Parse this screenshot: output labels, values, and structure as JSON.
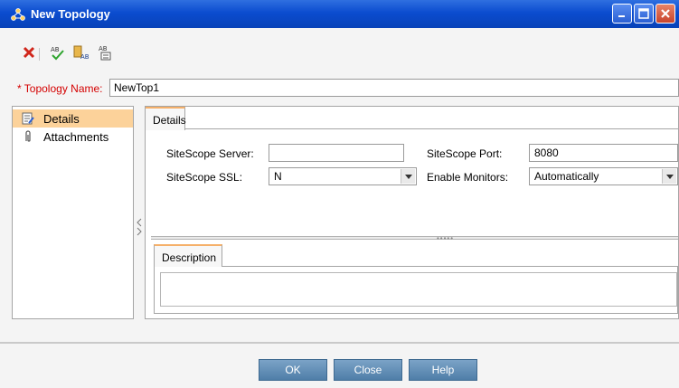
{
  "window": {
    "title": "New Topology"
  },
  "toolbar": {
    "buttons": [
      {
        "icon": "delete-x-icon"
      },
      {
        "icon": "spell-check-icon"
      },
      {
        "icon": "ab-format-icon"
      },
      {
        "icon": "ab-list-icon"
      }
    ]
  },
  "topology": {
    "name_label": "* Topology Name:",
    "name_value": "NewTop1"
  },
  "nav": {
    "items": [
      {
        "label": "Details",
        "icon": "details-icon",
        "selected": true
      },
      {
        "label": "Attachments",
        "icon": "paperclip-icon",
        "selected": false
      }
    ]
  },
  "details": {
    "tab_label": "Details",
    "fields": {
      "server_label": "SiteScope Server:",
      "server_value": "",
      "port_label": "SiteScope Port:",
      "port_value": "8080",
      "ssl_label": "SiteScope SSL:",
      "ssl_value": "N",
      "enable_label": "Enable Monitors:",
      "enable_value": "Automatically"
    },
    "description_tab": "Description"
  },
  "footer": {
    "ok": "OK",
    "close": "Close",
    "help": "Help"
  },
  "colors": {
    "title_bar": "#0b4ccf",
    "selected_nav": "#fcd29a",
    "required_label": "#d40000",
    "button": "#5b87b0"
  }
}
